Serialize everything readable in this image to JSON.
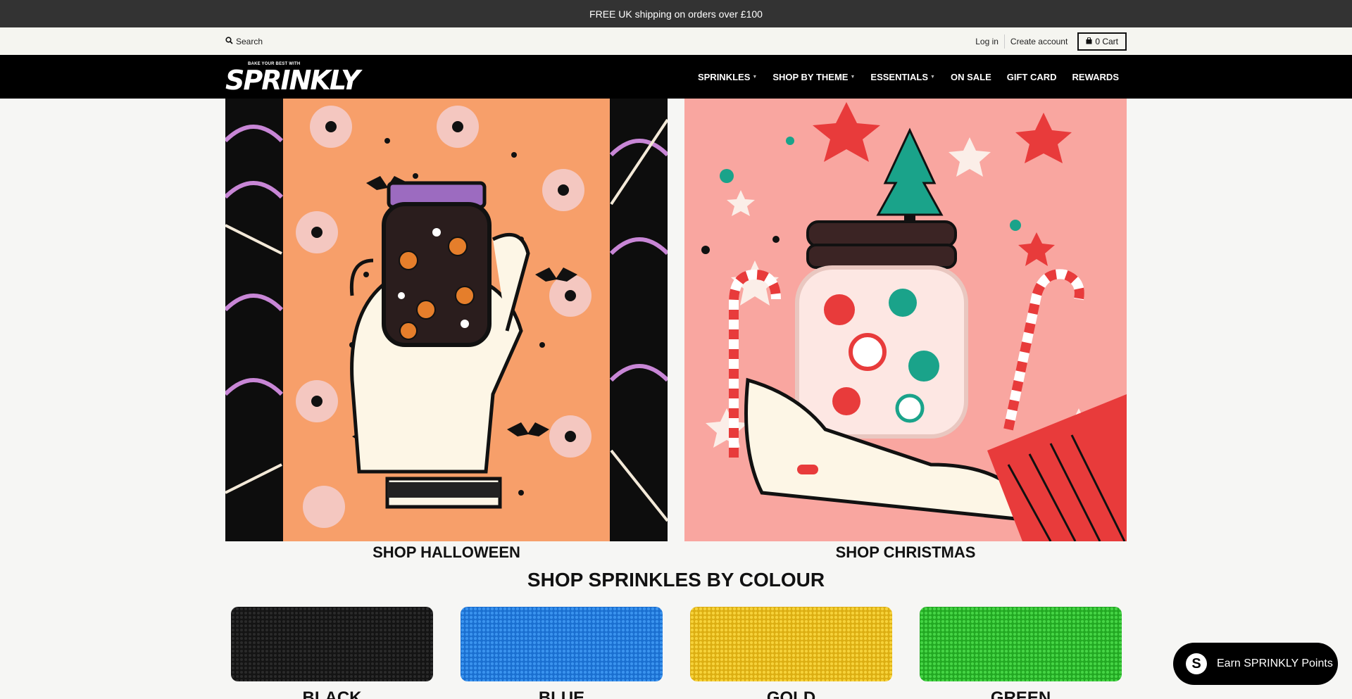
{
  "announcement": "FREE UK shipping on orders over £100",
  "utility": {
    "search": "Search",
    "login": "Log in",
    "create_account": "Create account",
    "cart": "0 Cart"
  },
  "logo": {
    "tagline": "BAKE YOUR BEST WITH",
    "wordmark": "SPRINKLY"
  },
  "nav": [
    {
      "label": "SPRINKLES",
      "has_dropdown": true
    },
    {
      "label": "SHOP BY THEME",
      "has_dropdown": true
    },
    {
      "label": "ESSENTIALS",
      "has_dropdown": true
    },
    {
      "label": "ON SALE",
      "has_dropdown": false
    },
    {
      "label": "GIFT CARD",
      "has_dropdown": false
    },
    {
      "label": "REWARDS",
      "has_dropdown": false
    }
  ],
  "promos": [
    {
      "label": "SHOP HALLOWEEN",
      "image": "halloween-jar-illustration"
    },
    {
      "label": "SHOP CHRISTMAS",
      "image": "christmas-jar-illustration"
    }
  ],
  "colour_section": {
    "title": "SHOP SPRINKLES BY COLOUR",
    "swatches": [
      {
        "label": "BLACK",
        "color": "#141414"
      },
      {
        "label": "BLUE",
        "color": "#1f7fe0"
      },
      {
        "label": "GOLD",
        "color": "#f0c419"
      },
      {
        "label": "GREEN",
        "color": "#2fc42f"
      }
    ]
  },
  "points_widget": {
    "label": "Earn SPRINKLY Points",
    "icon": "sprinkly-s-icon"
  },
  "colors": {
    "announcement_bg": "#333333",
    "nav_bg": "#000000",
    "page_bg": "#f6f6f4"
  }
}
